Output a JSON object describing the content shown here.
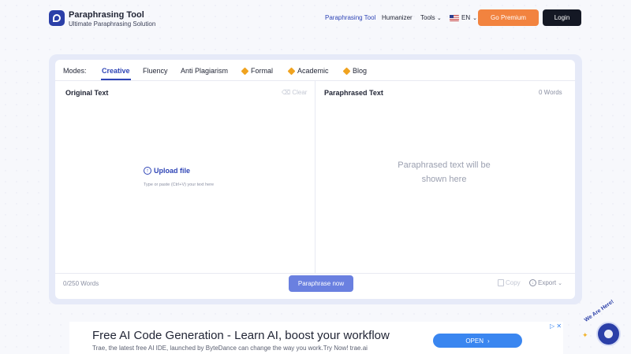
{
  "header": {
    "brand_title": "Paraphrasing Tool",
    "brand_subtitle": "Ultimate Paraphrasing Solution",
    "nav_paraphrasing": "Paraphrasing Tool",
    "nav_humanizer": "Humanizer",
    "nav_tools": "Tools",
    "nav_lang": "EN",
    "premium_label": "Go Premium",
    "login_label": "Login"
  },
  "modes": {
    "label": "Modes:",
    "items": [
      "Creative",
      "Fluency",
      "Anti Plagiarism",
      "Formal",
      "Academic",
      "Blog"
    ],
    "active": "Creative"
  },
  "left_panel": {
    "title": "Original Text",
    "clear_label": "Clear",
    "upload_label": "Upload file",
    "hint": "Type or paste (Ctrl+V) your text here",
    "word_count": "0/250 Words"
  },
  "right_panel": {
    "title": "Paraphrased Text",
    "word_count": "0 Words",
    "placeholder": "Paraphrased text will be shown here",
    "copy_label": "Copy",
    "export_label": "Export"
  },
  "actions": {
    "paraphrase_label": "Paraphrase now"
  },
  "ad": {
    "title": "Free AI Code Generation - Learn AI, boost your workflow",
    "description": "Trae, the latest free AI IDE, launched by ByteDance can change the way you work.Try Now! trae.ai",
    "open_label": "OPEN",
    "close_icon": "ad-close-icon"
  },
  "chat": {
    "label": "We Are Here!"
  },
  "colors": {
    "accent": "#2f45b6",
    "premium": "#f2833f",
    "login": "#141824",
    "paraphrase_button": "#6a80e0",
    "premium_diamond": "#f0a31f"
  }
}
